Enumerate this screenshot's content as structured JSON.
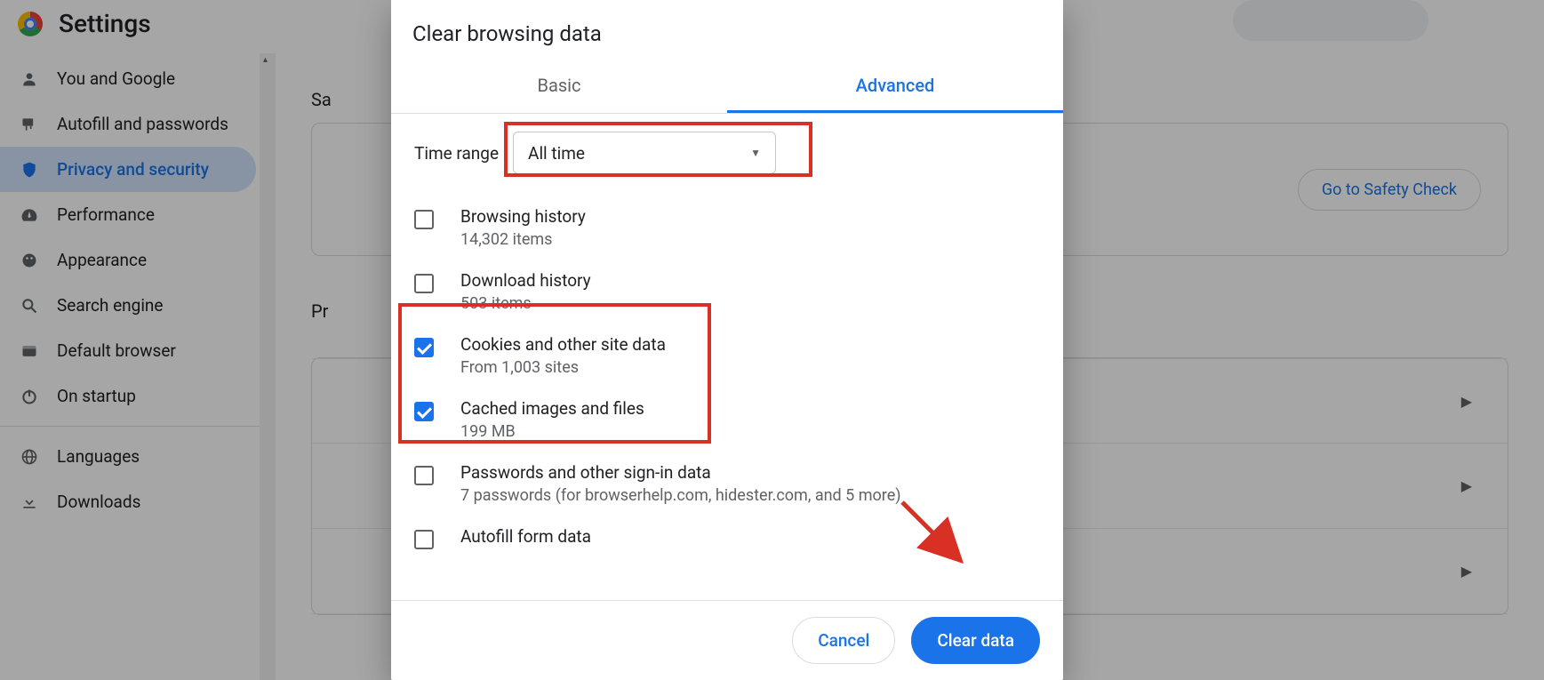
{
  "settings": {
    "title": "Settings",
    "sidebar": [
      {
        "label": "You and Google",
        "icon": "person"
      },
      {
        "label": "Autofill and passwords",
        "icon": "key"
      },
      {
        "label": "Privacy and security",
        "icon": "shield",
        "active": true
      },
      {
        "label": "Performance",
        "icon": "speed"
      },
      {
        "label": "Appearance",
        "icon": "palette"
      },
      {
        "label": "Search engine",
        "icon": "search"
      },
      {
        "label": "Default browser",
        "icon": "browser"
      },
      {
        "label": "On startup",
        "icon": "power"
      }
    ],
    "sidebar2": [
      {
        "label": "Languages",
        "icon": "globe"
      },
      {
        "label": "Downloads",
        "icon": "download"
      }
    ],
    "main": {
      "section1_heading_partial": "Sa",
      "safety_btn": "Go to Safety Check",
      "section2_heading_partial": "Pr"
    }
  },
  "dialog": {
    "title": "Clear browsing data",
    "tabs": {
      "basic": "Basic",
      "advanced": "Advanced"
    },
    "time_range_label": "Time range",
    "time_range_value": "All time",
    "options": [
      {
        "primary": "Browsing history",
        "secondary": "14,302 items",
        "checked": false
      },
      {
        "primary": "Download history",
        "secondary": "503 items",
        "checked": false
      },
      {
        "primary": "Cookies and other site data",
        "secondary": "From 1,003 sites",
        "checked": true
      },
      {
        "primary": "Cached images and files",
        "secondary": "199 MB",
        "checked": true
      },
      {
        "primary": "Passwords and other sign-in data",
        "secondary": "7 passwords (for browserhelp.com, hidester.com, and 5 more)",
        "checked": false
      },
      {
        "primary": "Autofill form data",
        "secondary": "",
        "checked": false
      }
    ],
    "cancel": "Cancel",
    "clear": "Clear data"
  }
}
